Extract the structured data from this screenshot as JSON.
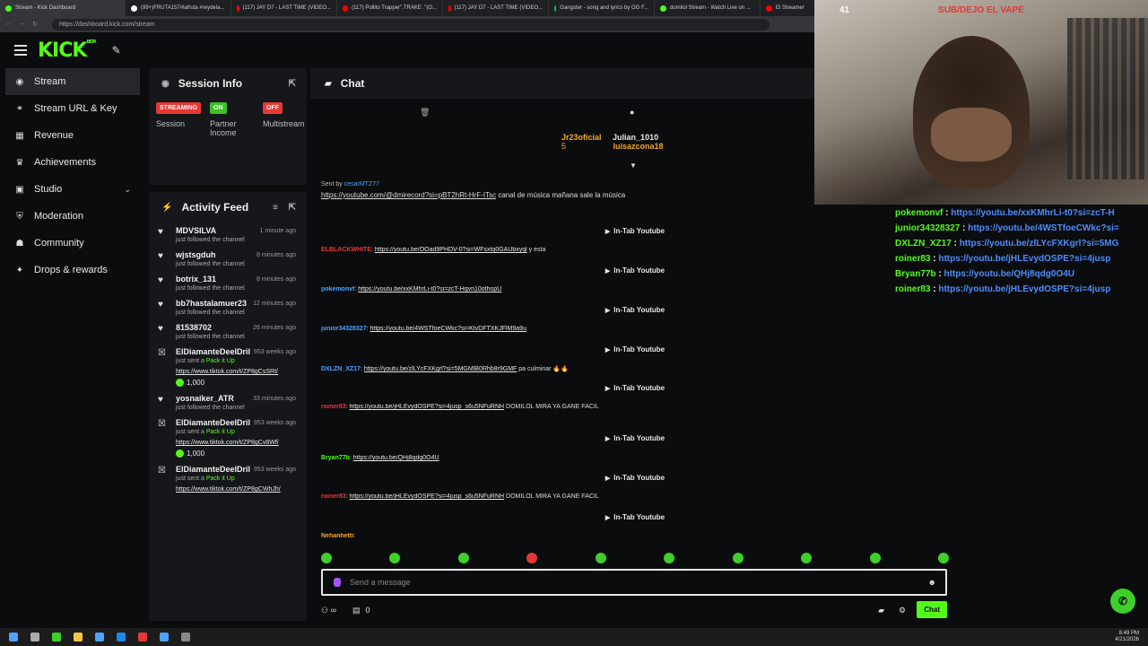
{
  "browser": {
    "tabs": [
      {
        "label": "Stream - Kick Dashboard",
        "color": "#53fc18"
      },
      {
        "label": "(99+)FRUTA157#lafruta #reydela...",
        "color": "#ffffff"
      },
      {
        "label": "(117) JAY D7 - LAST TIME (VIDEO...",
        "color": "#ff0000"
      },
      {
        "label": "(117) Pollito Trapper\".TRAKE .\"(O...",
        "color": "#ff0000"
      },
      {
        "label": "(117) JAY D7 - LAST TIME (VIDEO...",
        "color": "#ff0000"
      },
      {
        "label": "Gangster - song and lyrics by OG F...",
        "color": "#1db954"
      },
      {
        "label": "domilol Stream - Watch Live on ...",
        "color": "#53fc18"
      },
      {
        "label": "El Streamer",
        "color": "#ff0000"
      }
    ],
    "url": "https://dashboard.kick.com/stream"
  },
  "app": {
    "logo": "KICK",
    "logo_sup": "BETA"
  },
  "sidebar": {
    "items": [
      {
        "label": "Stream",
        "icon": "broadcast-icon",
        "glyph": "◉"
      },
      {
        "label": "Stream URL & Key",
        "icon": "link-icon",
        "glyph": "⚭"
      },
      {
        "label": "Revenue",
        "icon": "bank-icon",
        "glyph": "▦"
      },
      {
        "label": "Achievements",
        "icon": "trophy-icon",
        "glyph": "♛"
      },
      {
        "label": "Studio",
        "icon": "studio-icon",
        "glyph": "▣"
      },
      {
        "label": "Moderation",
        "icon": "shield-icon",
        "glyph": "⛨"
      },
      {
        "label": "Community",
        "icon": "community-icon",
        "glyph": "☗"
      },
      {
        "label": "Drops & rewards",
        "icon": "gift-icon",
        "glyph": "✦"
      }
    ]
  },
  "session": {
    "title": "Session Info",
    "cols": [
      {
        "badge": "STREAMING",
        "badge_color": "#e53935",
        "label": "Session"
      },
      {
        "badge": "ON",
        "badge_color": "#3fbf2a",
        "label": "Partner Income"
      },
      {
        "badge": "OFF",
        "badge_color": "#e53935",
        "label": "Multistream"
      }
    ]
  },
  "activity": {
    "title": "Activity Feed",
    "items": [
      {
        "name": "MDVSILVA",
        "time": "1 minute ago",
        "sub": "just followed the channel",
        "type": "follow"
      },
      {
        "name": "wjstsgduh",
        "time": "8 minutes ago",
        "sub": "just followed the channel",
        "type": "follow"
      },
      {
        "name": "botrix_131",
        "time": "8 minutes ago",
        "sub": "just followed the channel",
        "type": "follow"
      },
      {
        "name": "bb7hastalamuer23",
        "time": "12 minutes ago",
        "sub": "just followed the channel",
        "type": "follow"
      },
      {
        "name": "81538702",
        "time": "26 minutes ago",
        "sub": "just followed the channel",
        "type": "follow"
      },
      {
        "name": "ElDiamanteDeelDril",
        "time": "953 weeks ago",
        "sub_pre": "just sent a ",
        "sub_b": "Pack it Up",
        "link": "https://www.tiktok.com/t/ZP8gCsSRt/",
        "amount": "1,000",
        "type": "gift"
      },
      {
        "name": "yosnaiker_ATR",
        "time": "33 minutes ago",
        "sub": "just followed the channel",
        "type": "follow"
      },
      {
        "name": "ElDiamanteDeelDril",
        "time": "953 weeks ago",
        "sub_pre": "just sent a ",
        "sub_b": "Pack it Up",
        "link": "https://www.tiktok.com/t/ZP8gCv8Wf/",
        "amount": "1,000",
        "type": "gift"
      },
      {
        "name": "ElDiamanteDeelDril",
        "time": "953 weeks ago",
        "sub_pre": "just sent a ",
        "sub_b": "Pack it Up",
        "link": "https://www.tiktok.com/t/ZP8gCWhJh/",
        "type": "gift"
      }
    ]
  },
  "chat": {
    "title": "Chat",
    "top_users": [
      "Jr23oficial",
      "Julian_1010",
      "luisazcona18"
    ],
    "top_count": "5",
    "pinned_sender": "cesarMTZ77",
    "pinned_label": "Sent by",
    "pinned_text": "https://youtube.com/@dmirecord?si=pBT2hRt-HrF-ITsc",
    "pinned_tail": "canal de música mañana sale la música",
    "intab": "In-Tab Youtube",
    "messages": [
      {
        "user": "ELBLACKWHITE",
        "color": "#e53935",
        "link": "https://youtu.be/OOad9PHDV-0?si=WFsxtq0GAUbxyql",
        "tail": " y esta"
      },
      {
        "user": "pokemonvf",
        "color": "#4da3ff",
        "link": "https://youtu.be/xxKMhrLi-t0?si=zcT-Hqvn10othopU",
        "tail": ""
      },
      {
        "user": "junior34328327",
        "color": "#4da3ff",
        "link": "https://youtu.be/4WSTfoeCWkc?si=KtvDFTXKJFlM9a9u",
        "tail": ""
      },
      {
        "user": "DXLZN_XZ17",
        "color": "#4da3ff",
        "link": "https://youtu.be/zlLYcFXKgrl?si=5MGMlB0Rhb8r9GMF",
        "tail": " pa culminar 🔥🔥"
      },
      {
        "user": "roiner83",
        "color": "#e53935",
        "link": "https://youtu.be/jHLEvydOSPE?si=4jusp_s6u5NFuRNH",
        "tail": " DOMILOL MIRA YA GANE FACIL"
      },
      {
        "user": "Bryan77b",
        "color": "#53fc18",
        "link": "https://youtu.be/QHj8qdg0O4U",
        "tail": ""
      },
      {
        "user": "roiner83",
        "color": "#e53935",
        "link": "https://youtu.be/jHLEvydOSPE?si=4jusp_s6u5NFuRNH",
        "tail": " DOMILOL MIRA YA GANE FACIL"
      },
      {
        "user": "Nehanhetti",
        "color": "#f5a623",
        "link": "",
        "tail": ""
      }
    ],
    "placeholder": "Send a message",
    "viewer_count": "0",
    "send_label": "Chat"
  },
  "webcam": {
    "banner": "SUB/DEJO EL VAPE",
    "counter": "41"
  },
  "overlay_chat": [
    {
      "user": "pokemonvf",
      "text": "https://youtu.be/xxKMhrLi-t0?si=zcT-H"
    },
    {
      "user": "junior34328327",
      "text": "https://youtu.be/4WSTfoeCWkc?si="
    },
    {
      "user": "DXLZN_XZ17",
      "text": "https://youtu.be/zlLYcFXKgrl?si=5MG"
    },
    {
      "user": "roiner83",
      "text": "https://youtu.be/jHLEvydOSPE?si=4jusp"
    },
    {
      "user": "Bryan77b",
      "text": "https://youtu.be/QHj8qdg0O4U"
    },
    {
      "user": "roiner83",
      "text": "https://youtu.be/jHLEvydOSPE?si=4jusp"
    }
  ],
  "taskbar": {
    "time": "8:49 PM",
    "date": "4/21/2026"
  }
}
